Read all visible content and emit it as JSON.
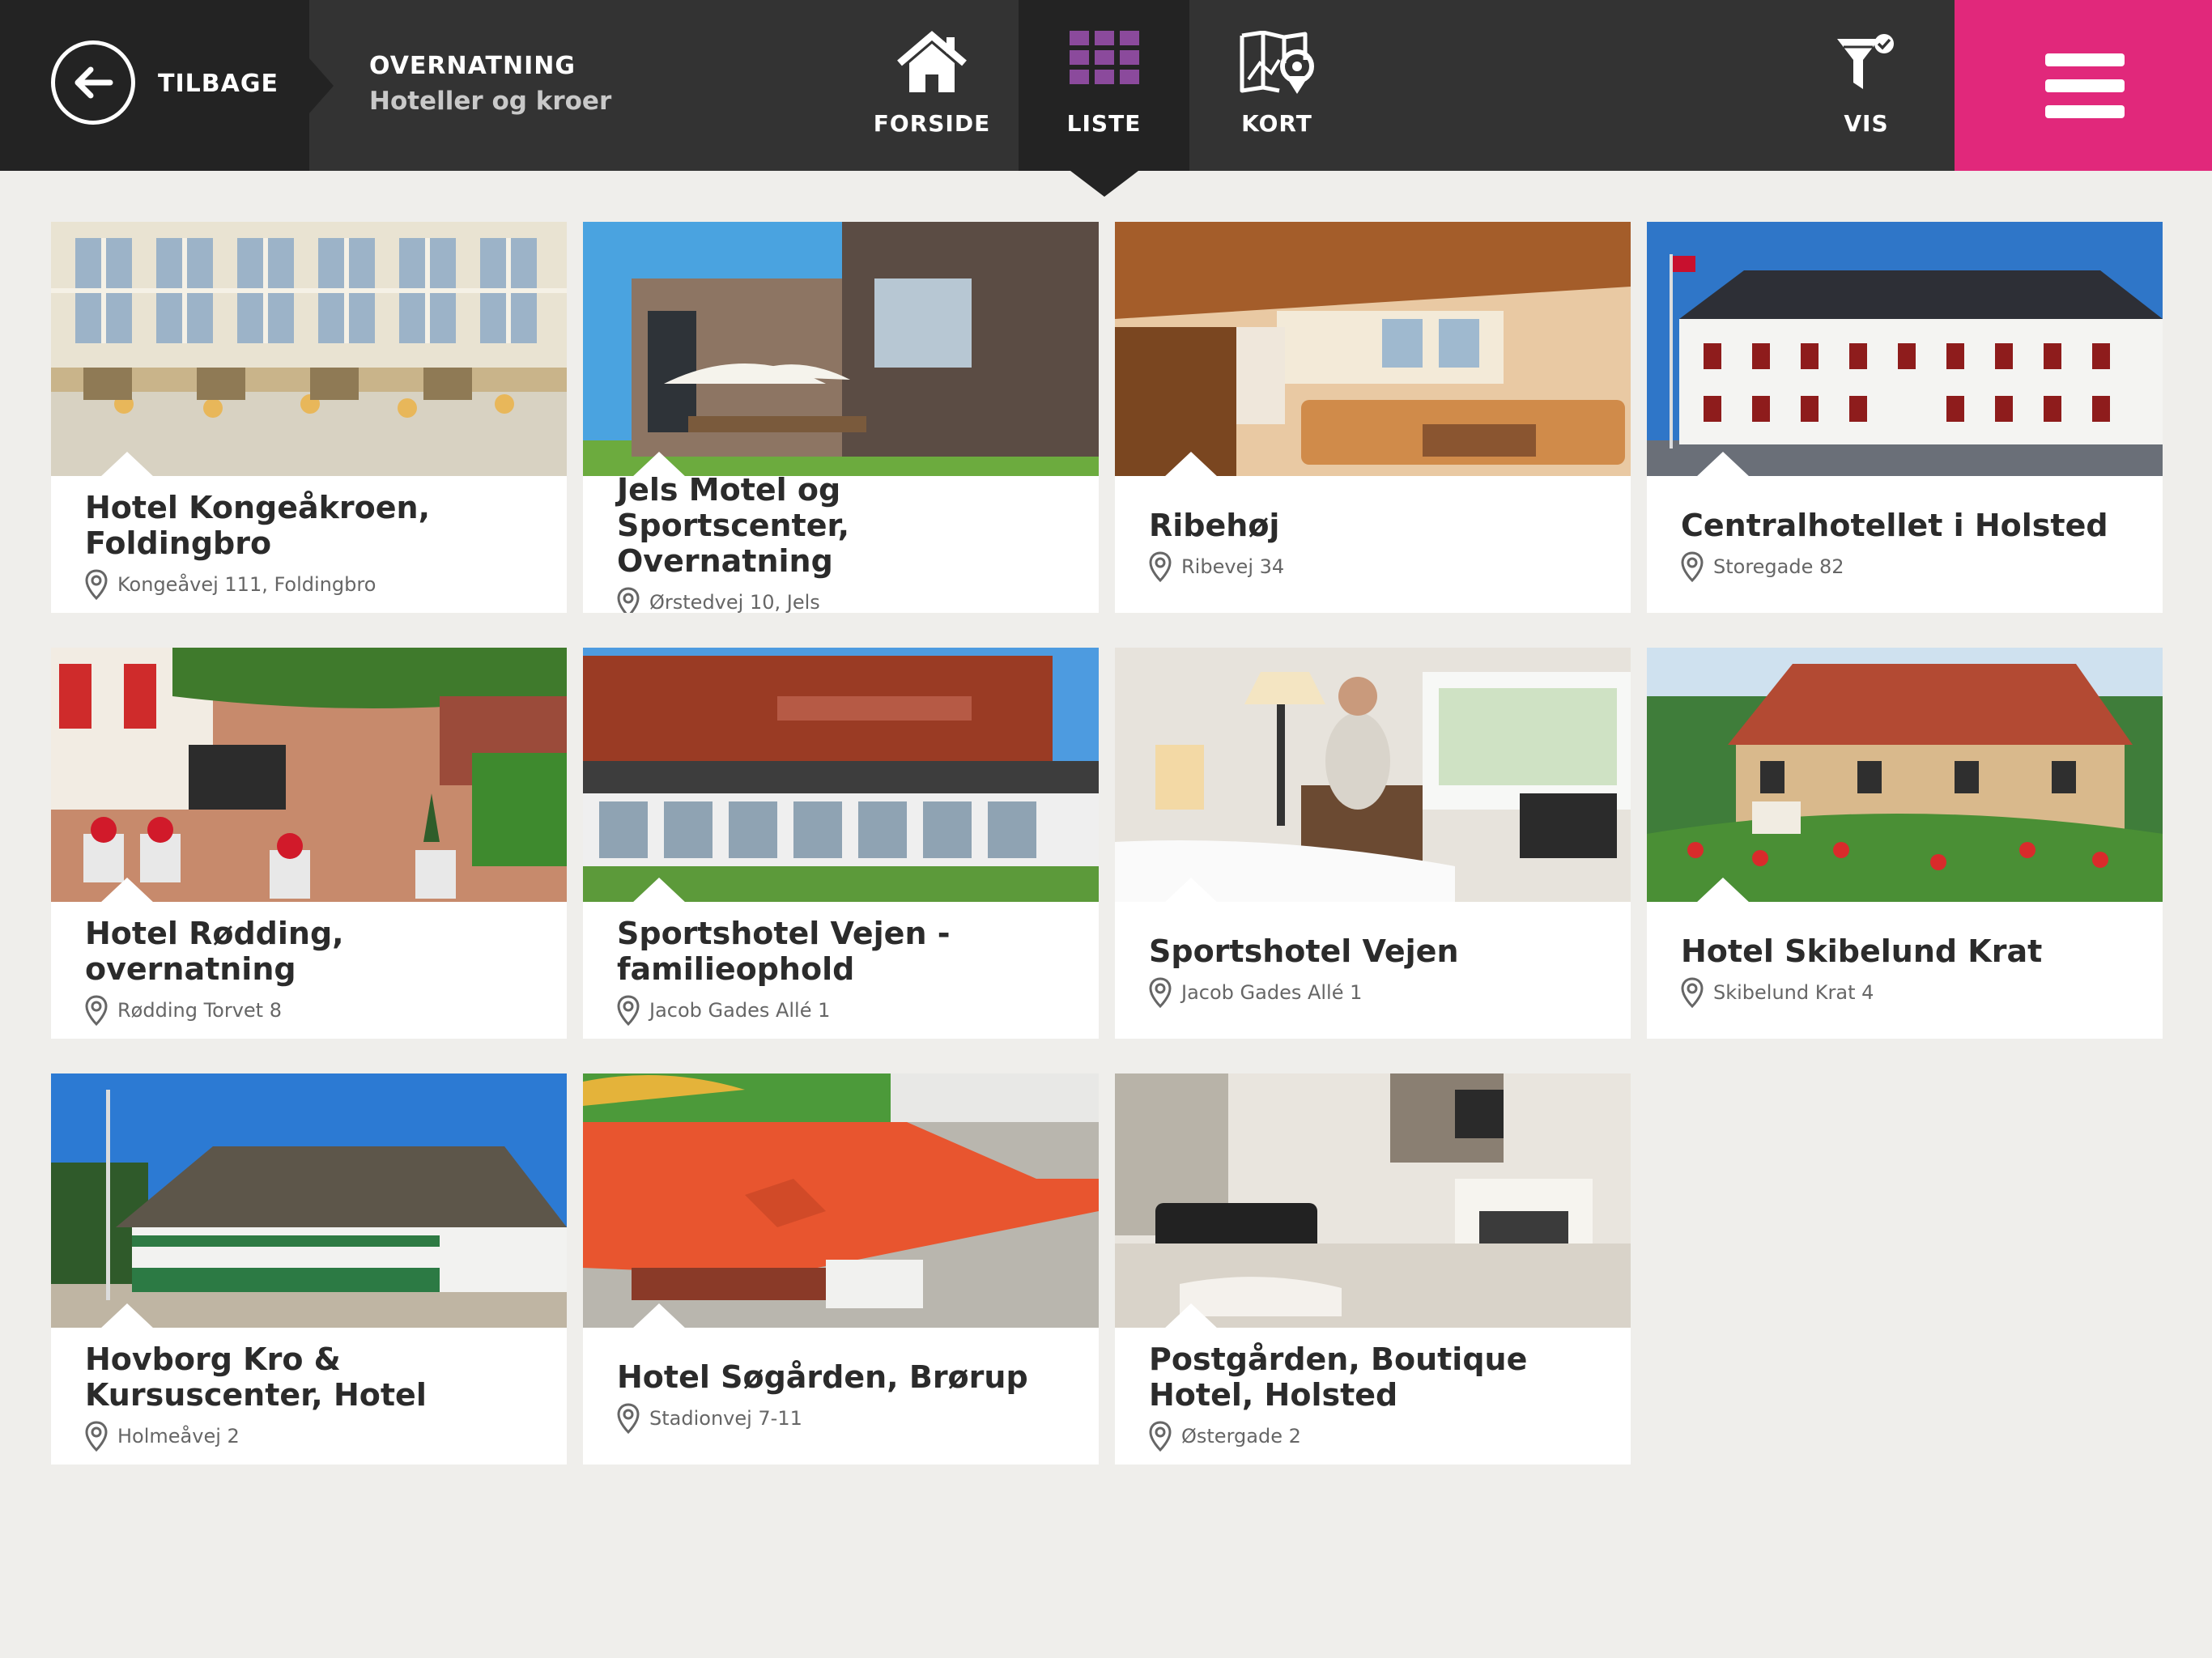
{
  "header": {
    "back_label": "TILBAGE",
    "section_title": "OVERNATNING",
    "section_subtitle": "Hoteller og kroer",
    "nav": [
      {
        "id": "home",
        "label": "FORSIDE",
        "icon": "home-icon",
        "active": false
      },
      {
        "id": "list",
        "label": "LISTE",
        "icon": "grid-icon",
        "active": true
      },
      {
        "id": "map",
        "label": "KORT",
        "icon": "map-icon",
        "active": false
      }
    ],
    "filter_label": "VIS",
    "filter_icon": "filter-icon",
    "menu_icon": "hamburger-menu-icon"
  },
  "colors": {
    "topbar": "#333333",
    "topbar_dark": "#232323",
    "accent_pink": "#e1287b",
    "list_icon_purple": "#8b4a9c",
    "background": "#efeeeb"
  },
  "listings": [
    {
      "title": "Hotel Kongeåkroen, Foldingbro",
      "address": "Kongeåvej 111, Foldingbro",
      "image": "dining-room-photo"
    },
    {
      "title": "Jels Motel og Sportscenter, Overnatning",
      "address": "Ørstedvej 10, Jels",
      "image": "modern-building-photo"
    },
    {
      "title": "Ribehøj",
      "address": "Ribevej 34",
      "image": "lounge-photo"
    },
    {
      "title": "Centralhotellet i Holsted",
      "address": "Storegade 82",
      "image": "white-hotel-photo"
    },
    {
      "title": "Hotel Rødding, overnatning",
      "address": "Rødding Torvet 8",
      "image": "terrace-photo"
    },
    {
      "title": "Sportshotel Vejen - familieophold",
      "address": "Jacob Gades Allé 1",
      "image": "sports-center-photo"
    },
    {
      "title": "Sportshotel Vejen",
      "address": "Jacob Gades Allé 1",
      "image": "hotel-room-photo"
    },
    {
      "title": "Hotel Skibelund Krat",
      "address": "Skibelund Krat 4",
      "image": "garden-hotel-photo"
    },
    {
      "title": "Hovborg Kro & Kursuscenter, Hotel",
      "address": "Holmeåvej 2",
      "image": "thatched-inn-photo"
    },
    {
      "title": "Hotel Søgården, Brørup",
      "address": "Stadionvej 7-11",
      "image": "aerial-roof-photo"
    },
    {
      "title": "Postgården, Boutique Hotel, Holsted",
      "address": "Østergade 2",
      "image": "boutique-room-photo"
    }
  ]
}
